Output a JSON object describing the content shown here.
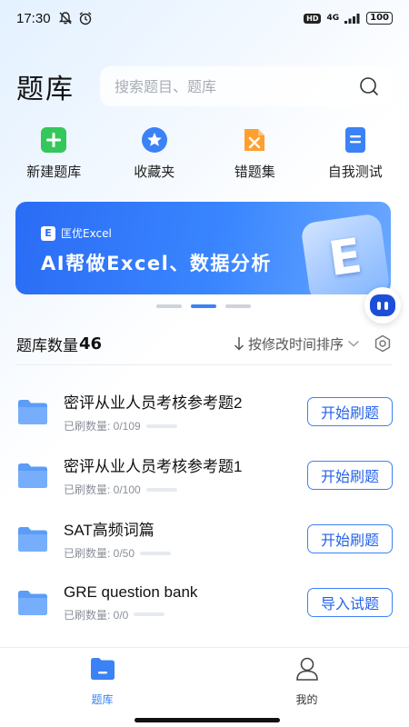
{
  "status_bar": {
    "time": "17:30",
    "hd": "HD",
    "network": "4G",
    "battery": "100"
  },
  "header": {
    "title": "题库",
    "search_placeholder": "搜索题目、题库"
  },
  "quick_actions": [
    {
      "label": "新建题库",
      "icon": "plus-icon",
      "color": "#34c759"
    },
    {
      "label": "收藏夹",
      "icon": "star-icon",
      "color": "#3b82f6"
    },
    {
      "label": "错题集",
      "icon": "wrong-icon",
      "color": "#ff9f2e"
    },
    {
      "label": "自我测试",
      "icon": "test-icon",
      "color": "#3b82f6"
    }
  ],
  "banner": {
    "brand": "匡优Excel",
    "brand_mark": "E",
    "headline": "AI帮做Excel、数据分析",
    "page_count": 3,
    "active_page": 2
  },
  "list_header": {
    "count_label": "题库数量",
    "count_value": "46",
    "sort_label": "按修改时间排序"
  },
  "banks": [
    {
      "name": "密评从业人员考核参考题2",
      "progress": "已刷数量: 0/109",
      "done": 0,
      "total": 109,
      "action": "开始刷题"
    },
    {
      "name": "密评从业人员考核参考题1",
      "progress": "已刷数量: 0/100",
      "done": 0,
      "total": 100,
      "action": "开始刷题"
    },
    {
      "name": "SAT高频词篇",
      "progress": "已刷数量: 0/50",
      "done": 0,
      "total": 50,
      "action": "开始刷题"
    },
    {
      "name": "GRE question bank",
      "progress": "已刷数量: 0/0",
      "done": 0,
      "total": 0,
      "action": "导入试题"
    }
  ],
  "bottom_nav": [
    {
      "label": "题库",
      "icon": "folder-icon",
      "active": true
    },
    {
      "label": "我的",
      "icon": "person-icon",
      "active": false
    }
  ],
  "colors": {
    "accent": "#3b82f6",
    "folder": "#5b9cf7"
  }
}
